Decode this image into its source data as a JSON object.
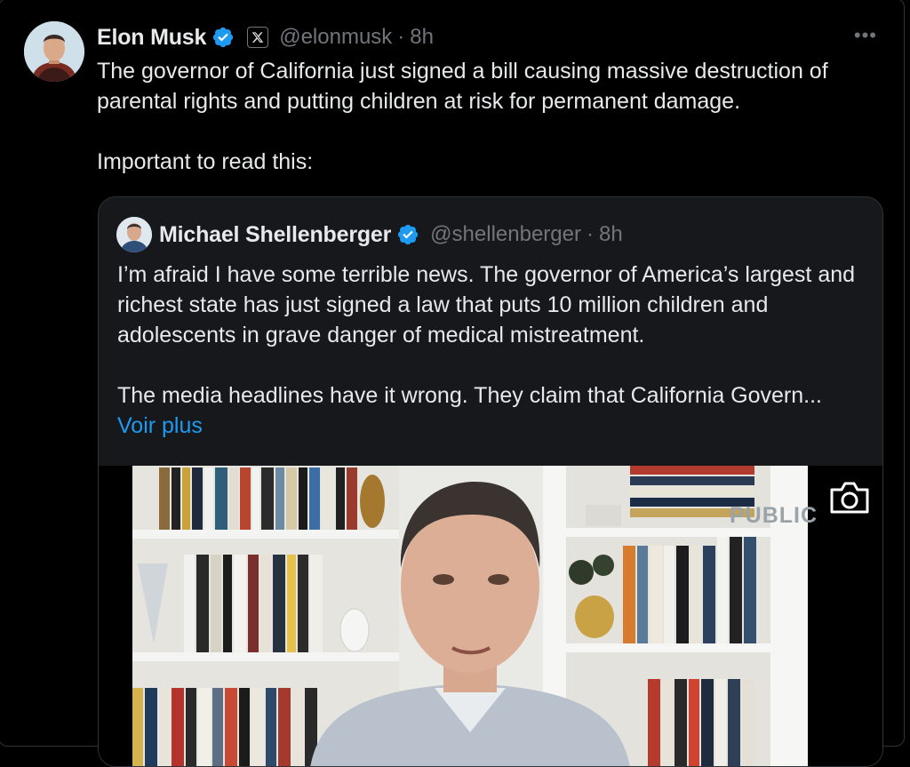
{
  "tweet": {
    "author_name": "Elon Musk",
    "handle": "@elonmusk",
    "separator": "·",
    "time": "8h",
    "more_label": "•••",
    "text_lines": [
      "The governor of California just signed a bill causing massive destruction of parental rights and putting children at risk for permanent damage.",
      "Important to read this:"
    ]
  },
  "quote": {
    "author_name": "Michael Shellenberger",
    "handle": "@shellenberger",
    "separator": "·",
    "time": "8h",
    "text_lines": [
      "I’m afraid I have some terrible news. The governor of America’s largest and richest state has just signed a law that puts 10 million children and adolescents in grave danger of medical mistreatment.",
      "The media headlines have it wrong. They claim that California Govern..."
    ],
    "see_more": "Voir plus",
    "media": {
      "watermark": "PUBLIC",
      "icon": "camera-icon"
    }
  },
  "colors": {
    "background": "#000000",
    "text": "#e7e9ea",
    "secondary": "#71767b",
    "link": "#1d9bf0",
    "verified": "#1d9bf0",
    "quote_bg": "#16181c",
    "border": "#2f3336"
  }
}
